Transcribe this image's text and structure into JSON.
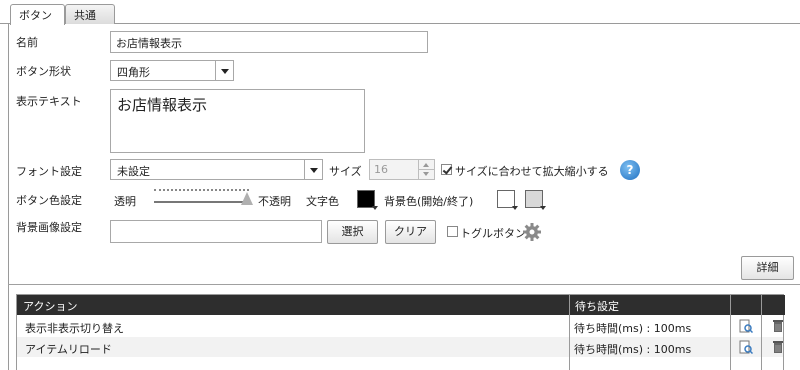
{
  "tabs": [
    {
      "label": "ボタン",
      "active": true
    },
    {
      "label": "共通",
      "active": false
    }
  ],
  "form": {
    "name_label": "名前",
    "name_value": "お店情報表示",
    "shape_label": "ボタン形状",
    "shape_value": "四角形",
    "display_text_label": "表示テキスト",
    "display_text_value": "お店情報表示",
    "font_label": "フォント設定",
    "font_value": "未設定",
    "size_label": "サイズ",
    "size_value": "16",
    "fit_size_label": "サイズに合わせて拡大縮小する",
    "fit_size_checked": true,
    "help_glyph": "?",
    "color_label": "ボタン色設定",
    "transparent_label": "透明",
    "opaque_label": "不透明",
    "opacity_level": 0.95,
    "text_color_label": "文字色",
    "text_color": "#000000",
    "bg_color_label": "背景色(開始/終了)",
    "bg_color_start": "#ffffff",
    "bg_color_end": "#d8d8d8",
    "bg_image_label": "背景画像設定",
    "bg_image_value": "",
    "select_button": "選択",
    "clear_button": "クリア",
    "toggle_label": "トグルボタン",
    "toggle_checked": false,
    "detail_button": "詳細"
  },
  "grid": {
    "headers": [
      "アクション",
      "待ち設定"
    ],
    "rows": [
      {
        "action": "表示非表示切り替え",
        "wait": "待ち時間(ms) : 100ms"
      },
      {
        "action": "アイテムリロード",
        "wait": "待ち時間(ms) : 100ms"
      }
    ]
  },
  "icons": {
    "help": "help-icon",
    "gear": "gear-icon",
    "edit": "edit-icon",
    "delete": "trash-icon"
  },
  "colors": {
    "header_bg": "#2e2e2e",
    "help_blue": "#1f6fc0"
  }
}
